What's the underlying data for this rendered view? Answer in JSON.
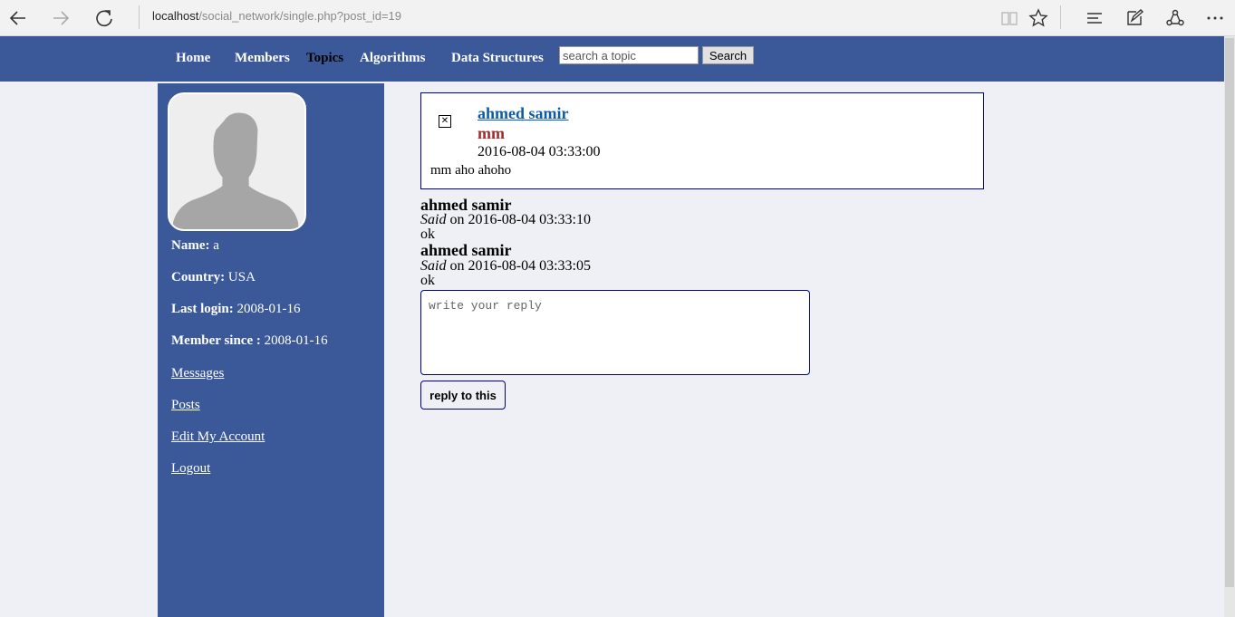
{
  "browser": {
    "url_host": "localhost",
    "url_path": "/social_network/single.php?post_id=19"
  },
  "nav": {
    "items": [
      {
        "label": "Home"
      },
      {
        "label": "Members"
      },
      {
        "label": "Topics"
      },
      {
        "label": "Algorithms"
      },
      {
        "label": "Data Structures"
      }
    ],
    "search_placeholder": "search a topic",
    "search_button": "Search"
  },
  "sidebar": {
    "name_label": "Name:",
    "name_value": "a",
    "country_label": "Country:",
    "country_value": "USA",
    "last_login_label": "Last login:",
    "last_login_value": "2008-01-16",
    "member_since_label": "Member since :",
    "member_since_value": "2008-01-16",
    "links": [
      {
        "label": "Messages"
      },
      {
        "label": "Posts"
      },
      {
        "label": "Edit My Account"
      },
      {
        "label": "Logout"
      }
    ]
  },
  "post": {
    "author": "ahmed samir",
    "title": "mm",
    "date": "2016-08-04 03:33:00",
    "body": "mm aho ahoho"
  },
  "replies": [
    {
      "name": "ahmed samir",
      "said": "Said",
      "on_date": "on 2016-08-04 03:33:10",
      "text": "ok"
    },
    {
      "name": "ahmed samir",
      "said": "Said",
      "on_date": "on 2016-08-04 03:33:05",
      "text": "ok"
    }
  ],
  "reply_form": {
    "placeholder": "write your reply",
    "button": "reply to this"
  },
  "colors": {
    "brand": "#3b5998",
    "post_border": "#00008b",
    "author_link": "#0b5ca8",
    "title": "#a52a2a"
  }
}
